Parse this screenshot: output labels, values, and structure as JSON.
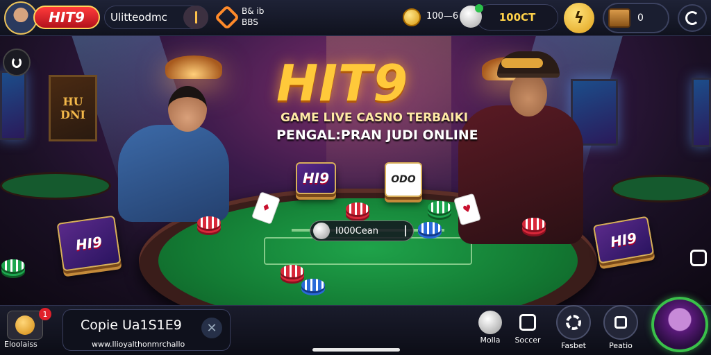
{
  "header": {
    "brand_label": "HIT9",
    "brand_name": "Ulitteodmc",
    "stat_line1": "B& ib",
    "stat_line2": "BBS",
    "odds_text": "100—6",
    "balance": "100CT",
    "chest_count": "0"
  },
  "hero": {
    "logo_text": "HIT9",
    "tagline_1": "GAME LIVE CASNO TERBAIKI",
    "tagline_2": "PENGAL:PRAN JUDI ONLINE",
    "poster_text": "HU DNI"
  },
  "table": {
    "bet_text": "I000Cean",
    "card_box_1": "HI9",
    "card_box_2": "ODO"
  },
  "footer": {
    "gift_label": "Eloolaiss",
    "gift_badge": "1",
    "promo_title": "Copie Ua1S1E9",
    "promo_url": "www.llioyalthonmrchallo",
    "nav": [
      {
        "label": "Molla",
        "icon": "soccer-ball-icon"
      },
      {
        "label": "Soccer",
        "icon": "scoreboard-icon"
      },
      {
        "label": "Fasbet",
        "icon": "gear-icon"
      },
      {
        "label": "Peatio",
        "icon": "square-icon"
      }
    ]
  },
  "colors": {
    "accent_gold": "#ffc93a",
    "brand_red": "#e0202a",
    "felt_green": "#137a33"
  }
}
